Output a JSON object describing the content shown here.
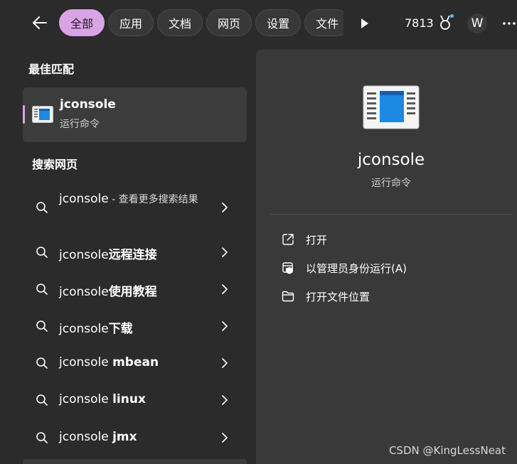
{
  "topbar": {
    "filters": [
      "全部",
      "应用",
      "文档",
      "网页",
      "设置",
      "文件"
    ],
    "active_filter": "全部",
    "points": "7813",
    "avatar_letter": "W",
    "accent": "#d9a3e6"
  },
  "best_match": {
    "section_title": "最佳匹配",
    "name": "jconsole",
    "subtitle": "运行命令"
  },
  "web_search": {
    "section_title": "搜索网页",
    "first": {
      "term": "jconsole",
      "suffix": " - 查看更多搜索结果"
    },
    "items": [
      {
        "prefix": "jconsole",
        "bold": "远程连接"
      },
      {
        "prefix": "jconsole",
        "bold": "使用教程"
      },
      {
        "prefix": "jconsole",
        "bold": "下载"
      },
      {
        "prefix": "jconsole ",
        "bold": "mbean"
      },
      {
        "prefix": "jconsole ",
        "bold": "linux"
      },
      {
        "prefix": "jconsole ",
        "bold": "jmx"
      }
    ]
  },
  "detail": {
    "title": "jconsole",
    "subtitle": "运行命令",
    "actions": [
      {
        "label": "打开",
        "icon": "open-external-icon"
      },
      {
        "label": "以管理员身份运行(A)",
        "icon": "admin-shield-icon"
      },
      {
        "label": "打开文件位置",
        "icon": "folder-icon"
      }
    ]
  },
  "watermark": "CSDN @KingLessNeat"
}
